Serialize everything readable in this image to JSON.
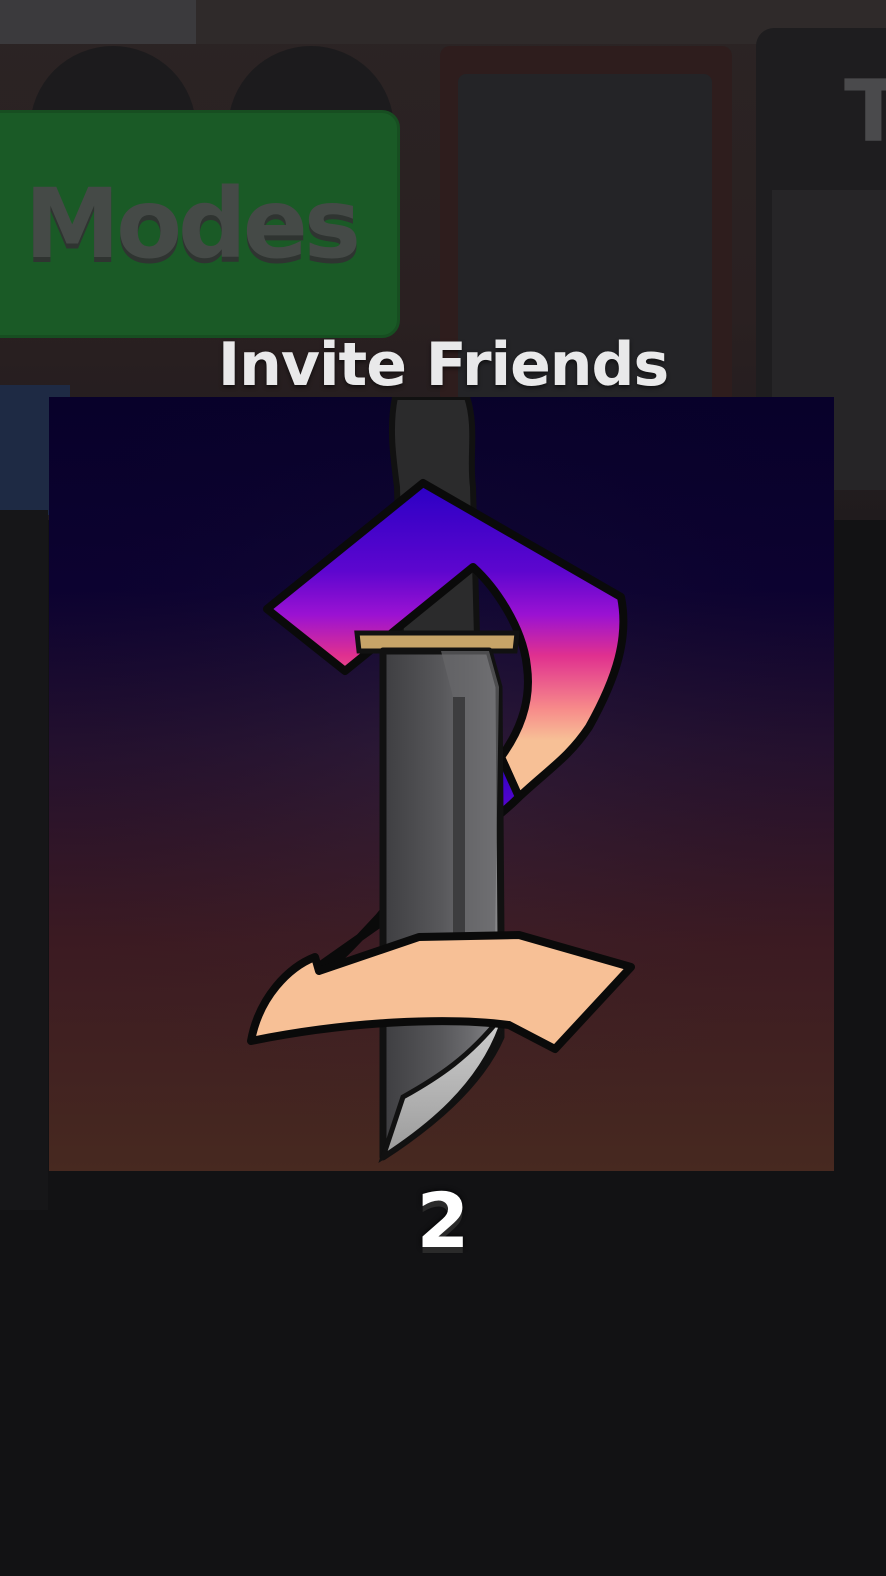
{
  "lobby": {
    "modes_button_label": "e Modes",
    "side_card_letter": "T",
    "invite_title": "Invite Friends"
  },
  "featured_game": {
    "name": "2",
    "icon": "dagger-number-two-logo",
    "colors": {
      "bg_top": "#08012a",
      "bg_bottom": "#472920",
      "stroke_top": "#2a00c4",
      "stroke_mid": "#d21fd8",
      "stroke_bottom": "#f7c096",
      "blade": "#4c4c4f",
      "guard": "#c7a468"
    }
  }
}
